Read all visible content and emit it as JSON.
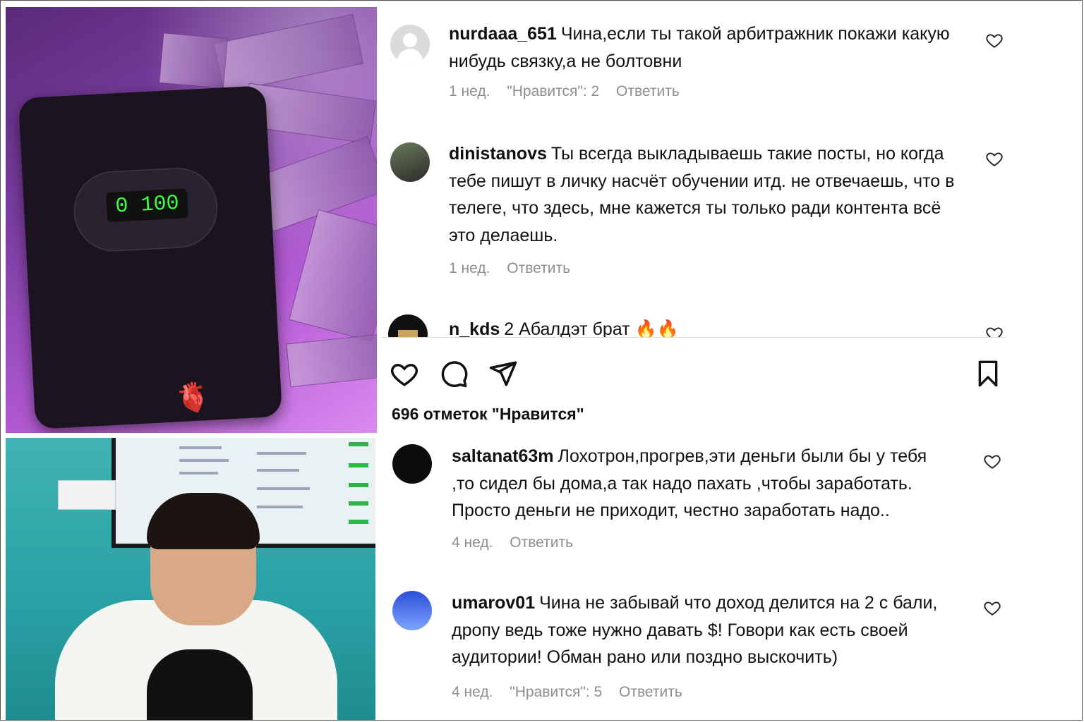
{
  "comments_top": [
    {
      "username": "nurdaaa_651",
      "text": "Чина,если ты такой арбитражник покажи какую нибудь связку,а не болтовни",
      "time": "1 нед.",
      "likes": "\"Нравится\": 2",
      "reply": "Ответить"
    },
    {
      "username": "dinistanovs",
      "text": "Ты всегда выкладываешь такие посты, но когда тебе пишут в личку насчёт обучении итд. не отвечаешь, что в телеге, что здесь, мне кажется ты только ради контента всё это делаешь.",
      "time": "1 нед.",
      "reply": "Ответить"
    },
    {
      "username": "n_kds",
      "text": "2 Абалдэт брат 🔥🔥"
    }
  ],
  "photo": {
    "counter_display": "0 100",
    "sticker": "🫀"
  },
  "post_actions": {
    "like_icon": "heart-outline-icon",
    "comment_icon": "speech-bubble-icon",
    "share_icon": "paper-plane-icon",
    "save_icon": "bookmark-icon",
    "likes_count": "696 отметок \"Нравится\""
  },
  "comments_bottom": [
    {
      "username": "saltanat63m",
      "text": "Лохотрон,прогрев,эти деньги были бы у тебя ,то сидел бы дома,а так надо пахать ,чтобы заработать. Просто деньги не приходит, честно заработать надо..",
      "time": "4 нед.",
      "reply": "Ответить"
    },
    {
      "username": "umarov01",
      "text": "Чина не забывай что доход делится на 2 с бали, дропу ведь тоже нужно давать $! Говори как есть своей аудитории! Обман рано или поздно выскочить)",
      "time": "4 нед.",
      "likes": "\"Нравится\": 5",
      "reply": "Ответить"
    }
  ]
}
